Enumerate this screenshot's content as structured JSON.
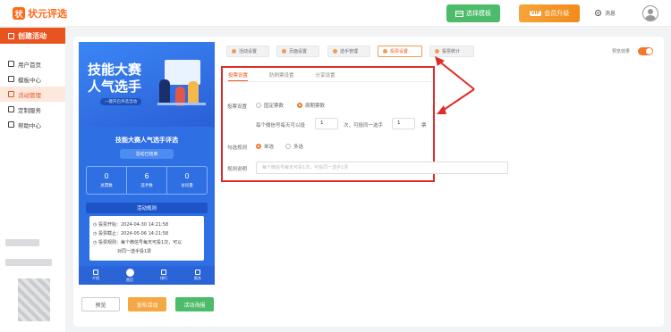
{
  "header": {
    "logo_text": "状元评选",
    "template_button": "选择模板",
    "upgrade_vip": "VIP",
    "upgrade_button": "会员升级",
    "message_label": "消息"
  },
  "sidebar": {
    "create_button": "创建活动",
    "items": [
      {
        "label": "用户首页"
      },
      {
        "label": "模板中心"
      },
      {
        "label": "活动管理"
      },
      {
        "label": "定制服务"
      },
      {
        "label": "帮助中心"
      }
    ]
  },
  "phone": {
    "banner_title_line1": "技能大赛",
    "banner_title_line2": "人气选手",
    "banner_sub": "一键开启评选活动",
    "activity_name": "技能大赛人气选手评选",
    "status": "活动已结束",
    "stats": [
      {
        "value": "0",
        "label": "总票数"
      },
      {
        "value": "6",
        "label": "选手数"
      },
      {
        "value": "0",
        "label": "访问量"
      }
    ],
    "rules_title": "活动规则",
    "rules": [
      "投票开始：2024-04-30 14:21:58",
      "投票截止：2024-05-06 14:21:58",
      "投票规则：每个微信号每天可投1次，可以",
      "对同一选手投1票"
    ],
    "tabs": [
      {
        "label": "介绍"
      },
      {
        "label": "首页"
      },
      {
        "label": "排行"
      },
      {
        "label": "报名"
      }
    ]
  },
  "actions": {
    "preview": "预览",
    "publish": "发布活动",
    "poster": "活动海报"
  },
  "settings_tabs": [
    {
      "label": "活动设置"
    },
    {
      "label": "页面设置"
    },
    {
      "label": "选手管理"
    },
    {
      "label": "投票设置"
    },
    {
      "label": "投票统计"
    }
  ],
  "preview_effect_label": "预览效果",
  "vote_settings": {
    "subtabs": [
      "投票设置",
      "防刷票设置",
      "分享设置"
    ],
    "vote_rule_label": "投票设置",
    "vote_rule_options": [
      "固定票数",
      "周期票数"
    ],
    "per_day_text": "每个微信号每天可以投",
    "per_day_value": "1",
    "per_day_suffix": "次，可投同一选手",
    "same_player_value": "1",
    "votes_unit": "票",
    "select_rule_label": "勾选规则",
    "select_options": [
      "单选",
      "多选"
    ],
    "rule_desc_label": "规则说明",
    "rule_desc_placeholder": "每个微信号每天可投1次，可投同一选手1票"
  }
}
